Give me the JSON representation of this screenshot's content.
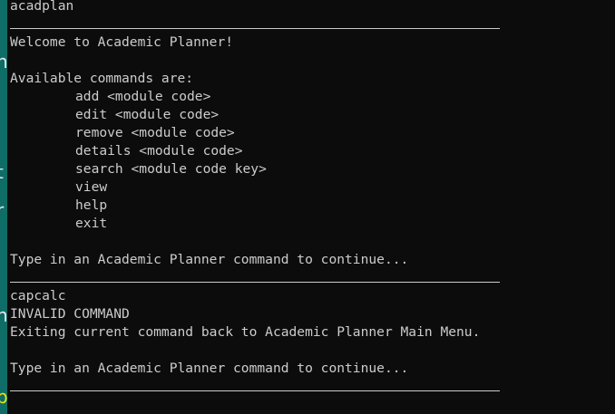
{
  "session_one": {
    "input_command": "acadplan",
    "welcome": "Welcome to Academic Planner!",
    "available_header": "Available commands are:",
    "commands": [
      "add <module code>",
      "edit <module code>",
      "remove <module code>",
      "details <module code>",
      "search <module code key>",
      "view",
      "help",
      "exit"
    ],
    "prompt": "Type in an Academic Planner command to continue..."
  },
  "session_two": {
    "input_command": "capcalc",
    "error": "INVALID COMMAND",
    "exit_message": "Exiting current command back to Academic Planner Main Menu.",
    "prompt": "Type in an Academic Planner command to continue..."
  },
  "left_strip": {
    "glyphs": [
      "n",
      "l",
      "t",
      "r",
      "i",
      "n",
      "i",
      "p"
    ]
  },
  "colors": {
    "background": "#0c0c0c",
    "text": "#cccccc",
    "strip": "#0f6d68",
    "strip_highlight": "#f2e600"
  }
}
